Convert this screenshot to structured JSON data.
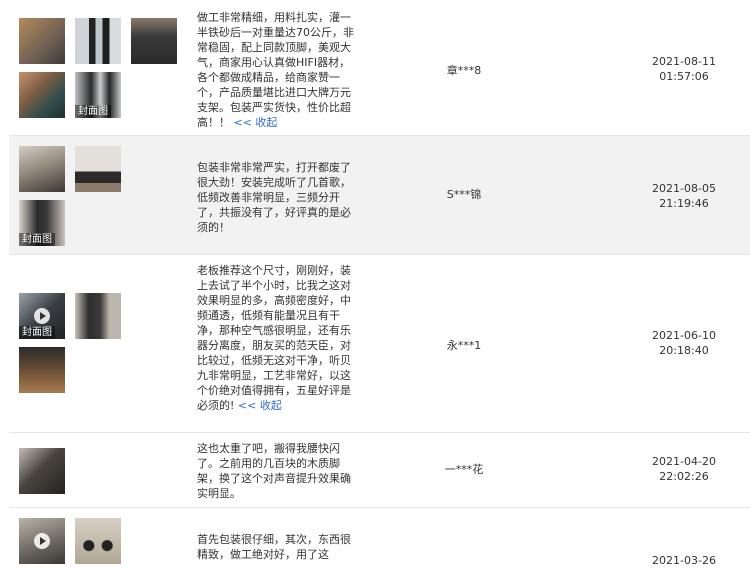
{
  "cover_label": "封面图",
  "reviews": [
    {
      "text": "做工非常精细，用料扎实，灌一半铁砂后一对重量达70公斤，非常稳固，配上同款顶脚，美观大气，商家用心认真做HIFI器材，各个都做成精品，给商家赞一个，产品质量堪比进口大牌万元支架。包装严实货快，性价比超高！！",
      "collapse_label": "<< 收起",
      "user": "章***8",
      "date": "2021-08-11",
      "time": "01:57:06"
    },
    {
      "text": "包装非常非常严实，打开都废了很大劲！安装完成听了几首歌，低频改善非常明显，三频分开了，共振没有了，好评真的是必须的！",
      "user": "S***锦",
      "date": "2021-08-05",
      "time": "21:19:46"
    },
    {
      "text": "老板推荐这个尺寸，刚刚好，装上去试了半个小时，比我之这对效果明显的多，高频密度好，中频通透，低频有能量况且有干净，那种空气感很明显，还有乐器分离度，朋友买的范天臣，对比较过，低频无这对干净，听贝九非常明显，工艺非常好，以这个价绝对值得拥有，五星好评是必须的!",
      "collapse_label": "<< 收起",
      "user": "永***1",
      "date": "2021-06-10",
      "time": "20:18:40"
    },
    {
      "text": "这也太重了吧，搬得我腰快闪了。之前用的几百块的木质脚架，换了这个对声音提升效果确实明显。",
      "user": "一***花",
      "date": "2021-04-20",
      "time": "22:02:26"
    },
    {
      "text": "首先包装很仔细，其次，东西很精致，做工绝对好，用了这",
      "user": "",
      "date": "2021-03-26",
      "time": ""
    }
  ]
}
